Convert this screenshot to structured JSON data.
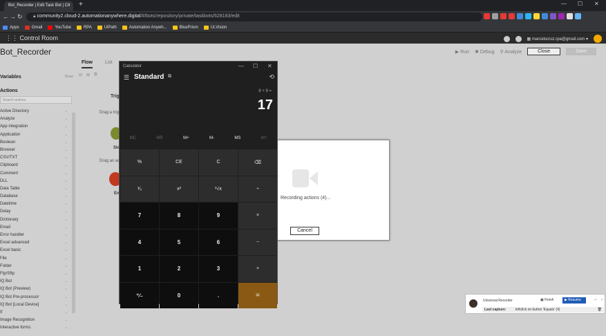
{
  "browser": {
    "tab_title": "Bot_Recorder | Edit Task Bot | Co",
    "tab_close": "×",
    "new_tab": "+",
    "win_min": "—",
    "win_max": "☐",
    "win_close": "✕",
    "url_domain": "community2.cloud-2.automationanywhere.digital",
    "url_path": "/#/bots/repository/private/taskbots/628183/edit",
    "bookmarks": [
      "Apps",
      "Gmail",
      "YouTube",
      "RPA",
      "UiPath",
      "Automation Anywh...",
      "BluePrism",
      "Ui.Vision"
    ],
    "bookmark_colors": [
      "#4c8bf5",
      "#d93025",
      "#ff0000",
      "#f5c518",
      "#f5c518",
      "#f5c518",
      "#f5c518",
      "#f5c518"
    ],
    "ext_colors": [
      "#e53935",
      "#9e9e9e",
      "#e53935",
      "#e53935",
      "#3f8bd8",
      "#29b6f6",
      "#fdd835",
      "#3f8bd8",
      "#7e57c2",
      "#9c27b0",
      "#e0e0e0",
      "#64b5f6"
    ]
  },
  "header": {
    "title": "Control Room",
    "user_email": "marcelocruz.rpa@gmail.com"
  },
  "app": {
    "bot_title": "Bot_Recorder",
    "run_label": "Run",
    "debug_label": "Debug",
    "analyze_label": "Analyze",
    "close_label": "Close",
    "save_label": "Save",
    "tabs": [
      "Flow",
      "List"
    ],
    "variables_label": "Variables",
    "show_label": "Show",
    "actions_label": "Actions",
    "search_placeholder": "Search actions",
    "actions": [
      "Active Directory",
      "Analyze",
      "App integration",
      "Application",
      "Boolean",
      "Browser",
      "CSV/TXT",
      "Clipboard",
      "Comment",
      "DLL",
      "Data Table",
      "Database",
      "Datetime",
      "Delay",
      "Dictionary",
      "Email",
      "Error handler",
      "Excel advanced",
      "Excel basic",
      "File",
      "Folder",
      "Ftp/Sftp",
      "IQ Bot",
      "IQ Bot (Preview)",
      "IQ Bot Pre-processor",
      "IQ Bot [Local Device]",
      "If",
      "Image Recognition",
      "Interactive forms"
    ],
    "trigger_label": "Trigg",
    "drag_trigger": "Drag a trig",
    "drag_action": "Drag an ac",
    "start_label": "Sta",
    "end_label": "En"
  },
  "recording_dialog": {
    "text": "Recording actions (4)...",
    "cancel_label": "Cancel"
  },
  "calculator": {
    "window_title": "Calculator",
    "mode": "Standard",
    "expression": "8 + 9 =",
    "result": "17",
    "memory": [
      "MC",
      "MR",
      "M+",
      "M-",
      "MS",
      "M˅"
    ],
    "memory_enabled": [
      false,
      false,
      true,
      true,
      true,
      false
    ],
    "keys": [
      "%",
      "CE",
      "C",
      "⌫",
      "¹⁄ₓ",
      "x²",
      "²√x",
      "÷",
      "7",
      "8",
      "9",
      "×",
      "4",
      "5",
      "6",
      "−",
      "1",
      "2",
      "3",
      "+",
      "⁺∕₋",
      "0",
      ".",
      "="
    ],
    "key_types": [
      "op",
      "op",
      "op",
      "op",
      "op",
      "op",
      "op",
      "op",
      "num",
      "num",
      "num",
      "op",
      "num",
      "num",
      "num",
      "op",
      "num",
      "num",
      "num",
      "op",
      "num",
      "num",
      "num",
      "eq"
    ]
  },
  "universal_recorder": {
    "title": "Universal Recorder",
    "finish_label": "Finish",
    "resume_label": "Resume",
    "last_capture_label": "Last capture:",
    "last_capture_value": "leftclick on button 'Equals' (4)"
  }
}
